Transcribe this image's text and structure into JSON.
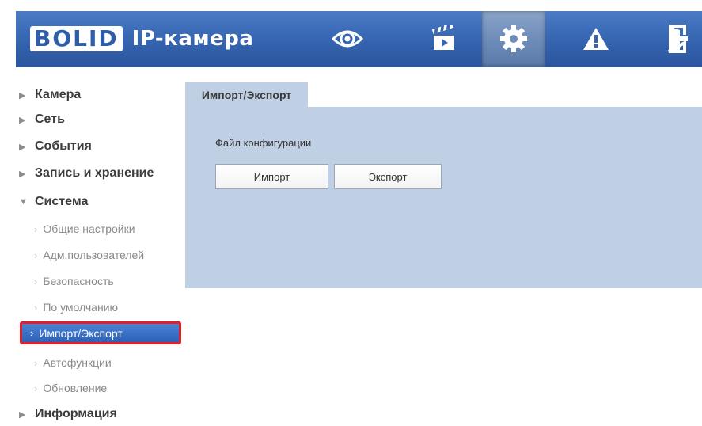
{
  "header": {
    "logo_text": "BOLID",
    "app_title": "IP-камера",
    "nav": [
      {
        "icon": "eye-icon",
        "name": "nav-live-view"
      },
      {
        "icon": "clapperboard-icon",
        "name": "nav-playback"
      },
      {
        "icon": "gear-icon",
        "name": "nav-settings",
        "active": true
      },
      {
        "icon": "warning-icon",
        "name": "nav-alarm"
      },
      {
        "icon": "exit-door-icon",
        "name": "nav-logout"
      }
    ]
  },
  "sidebar": {
    "items": [
      {
        "label": "Камера",
        "type": "top",
        "caret": "▶"
      },
      {
        "label": "Сеть",
        "type": "top",
        "caret": "▶"
      },
      {
        "label": "События",
        "type": "top",
        "caret": "▶"
      },
      {
        "label": "Запись и хранение",
        "type": "top",
        "caret": "▶"
      },
      {
        "label": "Система",
        "type": "top",
        "caret": "▼",
        "expanded": true
      },
      {
        "label": "Общие настройки",
        "type": "sub"
      },
      {
        "label": "Адм.пользователей",
        "type": "sub"
      },
      {
        "label": "Безопасность",
        "type": "sub"
      },
      {
        "label": "По умолчанию",
        "type": "sub"
      },
      {
        "label": "Импорт/Экспорт",
        "type": "sub",
        "selected": true
      },
      {
        "label": "Автофункции",
        "type": "sub"
      },
      {
        "label": "Обновление",
        "type": "sub"
      },
      {
        "label": "Информация",
        "type": "top",
        "caret": "▶"
      }
    ]
  },
  "content": {
    "tab_label": "Импорт/Экспорт",
    "section_label": "Файл конфигурации",
    "import_button": "Импорт",
    "export_button": "Экспорт"
  },
  "colors": {
    "header_blue": "#3564b0",
    "panel_bg": "#bfcfe4",
    "selected_bg": "#2b62b8",
    "highlight_border": "#e41e24"
  }
}
